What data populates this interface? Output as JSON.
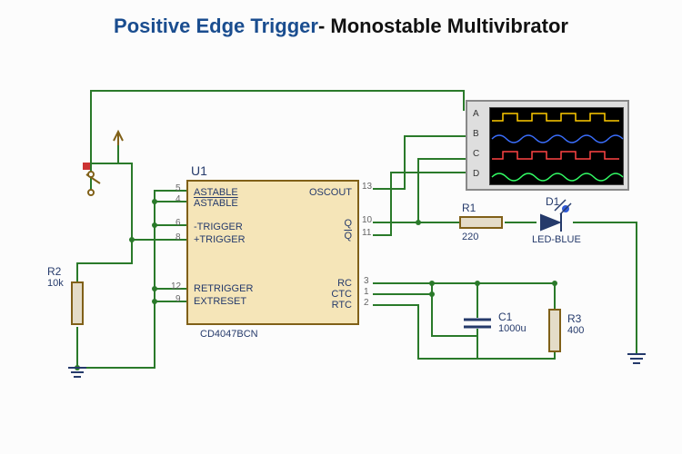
{
  "title": {
    "accent": "Positive Edge Trigger",
    "rest": "- Monostable Multivibrator"
  },
  "ic": {
    "ref": "U1",
    "part": "CD4047BCN",
    "pins_left": {
      "p5": "ASTABLE",
      "p4": "ASTABLE",
      "p6": "-TRIGGER",
      "p8": "+TRIGGER",
      "p12": "RETRIGGER",
      "p9": "EXTRESET"
    },
    "pins_right": {
      "p13": "OSCOUT",
      "p10": "Q",
      "p11": "Q",
      "p3": "RC",
      "p1": "CTC",
      "p2": "RTC"
    },
    "pin_nums": {
      "n5": "5",
      "n4": "4",
      "n6": "6",
      "n8": "8",
      "n12": "12",
      "n9": "9",
      "n13": "13",
      "n10": "10",
      "n11": "11",
      "n3": "3",
      "n1": "1",
      "n2": "2"
    }
  },
  "components": {
    "R1": {
      "ref": "R1",
      "value": "220"
    },
    "R2": {
      "ref": "R2",
      "value": "10k"
    },
    "R3": {
      "ref": "R3",
      "value": "400"
    },
    "C1": {
      "ref": "C1",
      "value": "1000u"
    },
    "D1": {
      "ref": "D1",
      "value": "LED-BLUE"
    }
  },
  "scope": {
    "channels": {
      "A": "A",
      "B": "B",
      "C": "C",
      "D": "D"
    }
  }
}
